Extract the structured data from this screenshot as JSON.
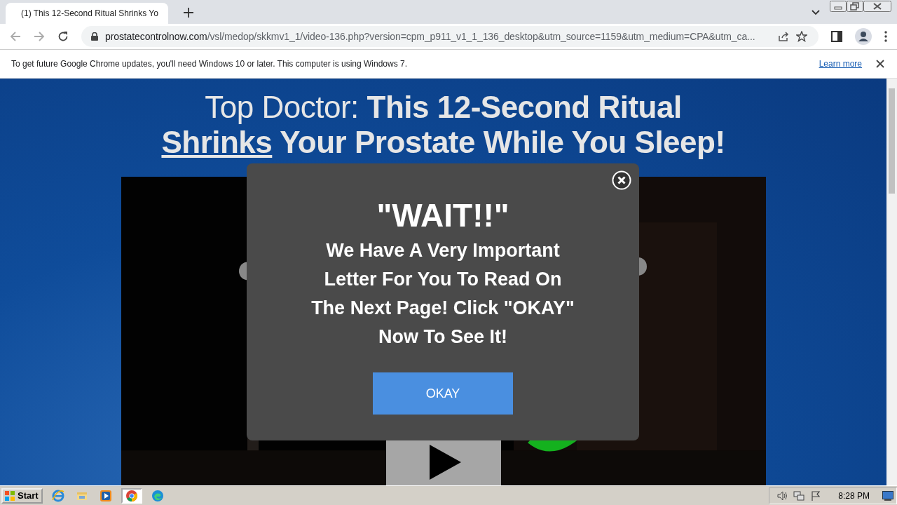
{
  "browser": {
    "tabs": [
      {
        "title": "(1) This 12-Second Ritual Shrinks Yo",
        "selected": true
      }
    ],
    "url": {
      "domain": "prostatecontrolnow.com",
      "path": "/vsl/medop/skkmv1_1/video-136.php?version=cpm_p911_v1_1_136_desktop&utm_source=1159&utm_medium=CPA&utm_ca..."
    },
    "infobar": {
      "message": "To get future Google Chrome updates, you'll need Windows 10 or later. This computer is using Windows 7.",
      "link": "Learn more"
    }
  },
  "page": {
    "headline_line_1": "Top Doctor: **This 12-Second Ritual**",
    "headline_link": "Shrinks",
    "headline_line_2_rest": " Your Prostate While You Sleep!"
  },
  "popup": {
    "title": "\"WAIT!!\"",
    "message": "We Have A Very Important Letter For You To Read On The Next Page! Click \"OKAY\" Now To See It!",
    "button": "OKAY"
  },
  "taskbar": {
    "start": "Start",
    "apps": [
      {
        "kind": "ie",
        "selected": false
      },
      {
        "kind": "folder",
        "selected": false
      },
      {
        "kind": "media",
        "selected": false
      },
      {
        "kind": "chrome",
        "selected": true
      },
      {
        "kind": "edge",
        "selected": false
      }
    ],
    "clock": "8:28 PM"
  }
}
